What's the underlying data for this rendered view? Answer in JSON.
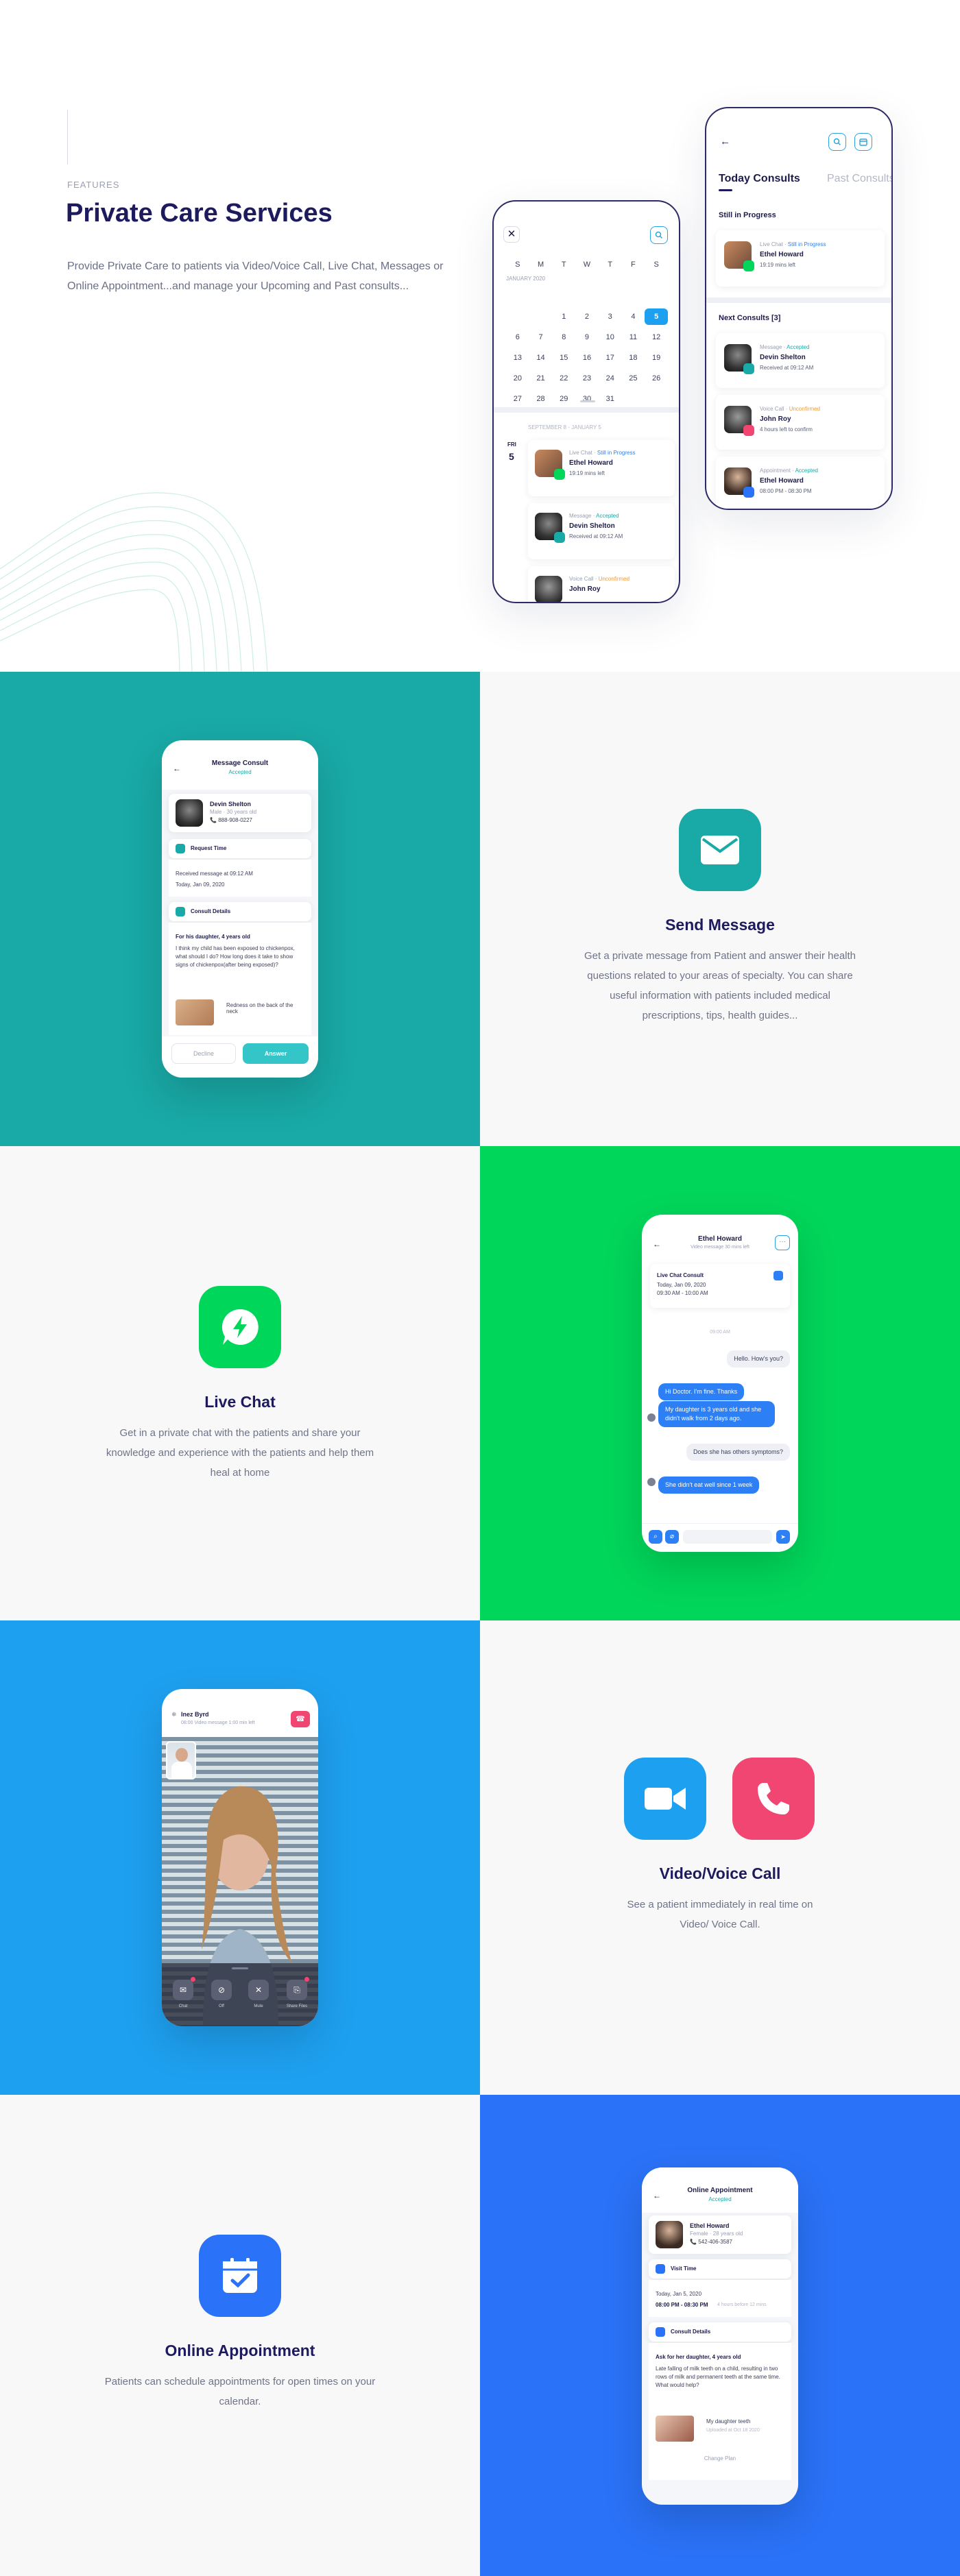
{
  "hero": {
    "kicker": "FEATURES",
    "title": "Private Care Services",
    "description": "Provide Private Care to patients via Video/Voice Call, Live Chat, Messages or Online Appointment...and manage your Upcoming and Past consults..."
  },
  "calendar_phone": {
    "weekdays": [
      "S",
      "M",
      "T",
      "W",
      "T",
      "F",
      "S"
    ],
    "month": "JANUARY 2020",
    "days": [
      "",
      "",
      "",
      "",
      "",
      "",
      "",
      "",
      "",
      "1",
      "2",
      "3",
      "4",
      "5",
      "6",
      "7",
      "8",
      "9",
      "10",
      "11",
      "12",
      "13",
      "14",
      "15",
      "16",
      "17",
      "18",
      "19",
      "20",
      "21",
      "22",
      "23",
      "24",
      "25",
      "26",
      "27",
      "28",
      "29",
      "30",
      "31"
    ],
    "selected_day": "5",
    "list_header": "SEPTEMBER 8 - JANUARY 5",
    "day_name": "FRI",
    "day_num": "5",
    "items": [
      {
        "type": "Live Chat",
        "status": "Still in Progress",
        "name": "Ethel Howard",
        "detail": "19:19 mins left"
      },
      {
        "type": "Message",
        "status": "Accepted",
        "name": "Devin Shelton",
        "detail": "Received at 09:12 AM"
      },
      {
        "type": "Voice Call",
        "status": "Unconfirmed",
        "name": "John Roy",
        "detail": ""
      }
    ]
  },
  "consults_phone": {
    "tab_today": "Today Consults",
    "tab_past": "Past Consults",
    "still_header": "Still in Progress",
    "next_header": "Next Consults [3]",
    "in_progress": {
      "type": "Live Chat",
      "status": "Still in Progress",
      "name": "Ethel Howard",
      "detail": "19:19 mins left"
    },
    "next": [
      {
        "type": "Message",
        "status": "Accepted",
        "name": "Devin Shelton",
        "detail": "Received at 09:12 AM"
      },
      {
        "type": "Voice Call",
        "status": "Unconfirmed",
        "name": "John Roy",
        "detail": "4 hours left to confirm"
      },
      {
        "type": "Appointment",
        "status": "Accepted",
        "name": "Ethel Howard",
        "detail": "08:00 PM - 08:30 PM"
      }
    ]
  },
  "message_phone": {
    "title": "Message Consult",
    "status": "Accepted",
    "patient_name": "Devin Shelton",
    "patient_info": "Male · 30 years old",
    "patient_phone": "888-908-0227",
    "request_label": "Request Time",
    "request_line1": "Received message at 09:12 AM",
    "request_line2": "Today, Jan 09, 2020",
    "consult_label": "Consult Details",
    "question_title": "For his daughter, 4 years old",
    "question_body": "I think my child has been exposed to chickenpox, what should I do? How long does it take to show signs of chickenpox(after being exposed)?",
    "attachment_caption": "Redness on the back of the neck",
    "decline": "Decline",
    "answer": "Answer"
  },
  "send_message": {
    "title": "Send Message",
    "description": "Get a private message from Patient and answer their health questions related to your areas of specialty. You can share useful information with patients included medical prescriptions, tips, health guides..."
  },
  "live_chat": {
    "title": "Live Chat",
    "description": "Get in a private chat with the patients and share your knowledge and experience with the patients and help them heal at home"
  },
  "chat_phone": {
    "name": "Ethel Howard",
    "sub": "Video message 30 mins left",
    "card_title": "Live Chat Consult",
    "card_date": "Today, Jan 09, 2020",
    "card_time": "09:30 AM - 10:00 AM",
    "divider": "09:00 AM",
    "messages": [
      {
        "side": "left",
        "text": "Hello. How's you?"
      },
      {
        "side": "right",
        "text": "Hi Doctor. I'm fine. Thanks"
      },
      {
        "side": "right",
        "text": "My daughter is 3 years old and she didn't walk from 2 days ago."
      },
      {
        "side": "left",
        "text": "Does she has others symptoms?"
      },
      {
        "side": "right",
        "text": "She didn't eat well since 1 week"
      }
    ]
  },
  "video_phone": {
    "name": "Inez Byrd",
    "sub": "08:00 Video message 1:00 min left",
    "controls": [
      "Chat",
      "Off",
      "Mute",
      "Share Files"
    ]
  },
  "video_call": {
    "title": "Video/Voice Call",
    "description": "See a patient immediately in real time on Video/ Voice Call."
  },
  "appointment": {
    "title": "Online Appointment",
    "description": "Patients can schedule appointments for open times on your calendar."
  },
  "appointment_phone": {
    "title": "Online Appointment",
    "status": "Accepted",
    "patient_name": "Ethel Howard",
    "patient_info": "Female · 28 years old",
    "patient_phone": "542-406-3587",
    "visit_label": "Visit Time",
    "visit_date": "Today, Jan 5, 2020",
    "visit_time": "08:00 PM - 08:30 PM",
    "visit_note": "4 hours before 12 mins",
    "consult_label": "Consult Details",
    "question_title": "Ask for her daughter, 4 years old",
    "question_body": "Late falling of milk teeth on a child, resulting in two rows of milk and permanent teeth at the same time. What would help?",
    "attachment_caption": "My daughter teeth",
    "attachment_date": "Uploaded at Oct 18 2020",
    "change_plan": "Change Plan"
  },
  "colors": {
    "teal": "#19a9a6",
    "green": "#00d65a",
    "blue": "#1ea0f0",
    "royal": "#2a72f7",
    "pink": "#f24672",
    "navy": "#1d1b5e",
    "light": "#f6f7f9"
  }
}
